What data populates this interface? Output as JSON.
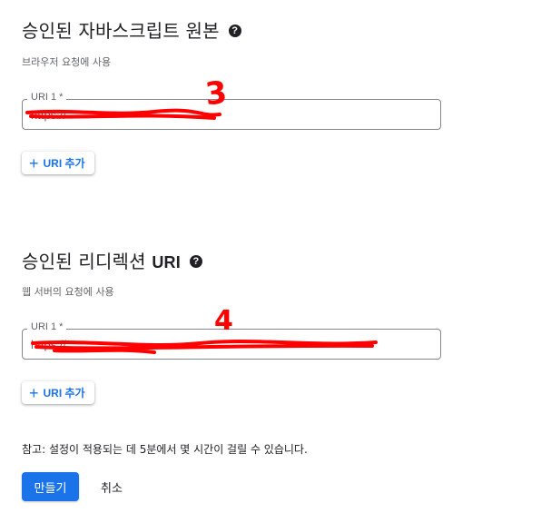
{
  "origins": {
    "title_ko": "승인된 자바스크립트 원본",
    "help_icon": "?",
    "subtitle": "브라우저 요청에 사용",
    "field_label": "URI 1 *",
    "field_value": "https://",
    "add_label": "URI 추가"
  },
  "redirects": {
    "title_ko": "승인된 리디렉션 ",
    "title_latin": "URI",
    "help_icon": "?",
    "subtitle": "웹 서버의 요청에 사용",
    "field_label": "URI 1 *",
    "field_value": "https://",
    "add_label": "URI 추가"
  },
  "annotations": {
    "mark_1": "3",
    "mark_2": "4",
    "color": "#ff0000"
  },
  "footer": {
    "note": "참고: 설정이 적용되는 데 5분에서 몇 시간이 걸릴 수 있습니다.",
    "create_label": "만들기",
    "cancel_label": "취소"
  },
  "icons": {
    "help": "help-circle-icon",
    "add": "plus-icon"
  },
  "colors": {
    "accent": "#1a73e8",
    "text": "#202124",
    "muted": "#5f6368"
  }
}
